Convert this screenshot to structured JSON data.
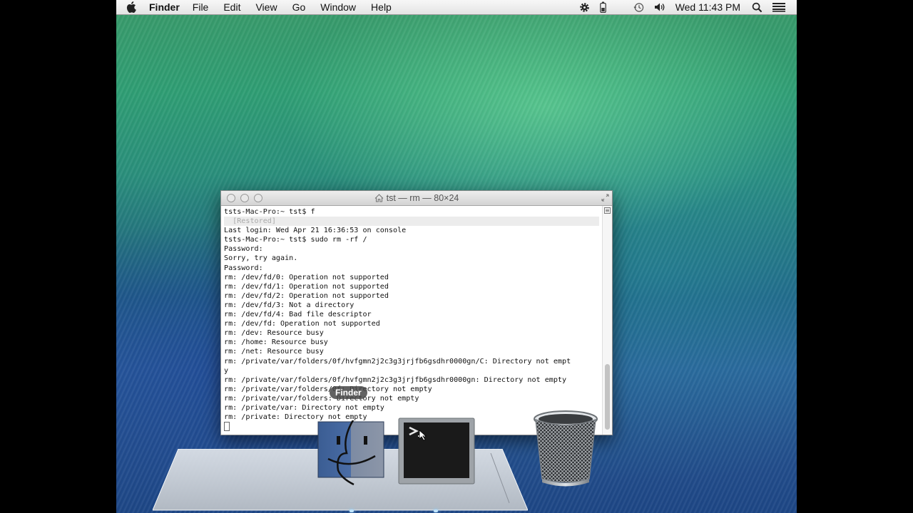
{
  "menubar": {
    "app_name": "Finder",
    "items": [
      "File",
      "Edit",
      "View",
      "Go",
      "Window",
      "Help"
    ],
    "clock": "Wed 11:43 PM",
    "status_icons": [
      "gear-icon",
      "battery-icon",
      "time-machine-icon",
      "volume-icon",
      "search-icon",
      "list-icon"
    ]
  },
  "terminal": {
    "title": "tst — rm — 80×24",
    "lines": [
      "tsts-Mac-Pro:~ tst$ f",
      "  [Restored]",
      "Last login: Wed Apr 21 16:36:53 on console",
      "tsts-Mac-Pro:~ tst$ sudo rm -rf /",
      "Password:",
      "Sorry, try again.",
      "Password:",
      "rm: /dev/fd/0: Operation not supported",
      "rm: /dev/fd/1: Operation not supported",
      "rm: /dev/fd/2: Operation not supported",
      "rm: /dev/fd/3: Not a directory",
      "rm: /dev/fd/4: Bad file descriptor",
      "rm: /dev/fd: Operation not supported",
      "rm: /dev: Resource busy",
      "rm: /home: Resource busy",
      "rm: /net: Resource busy",
      "rm: /private/var/folders/0f/hvfgmn2j2c3g3jrjfb6gsdhr0000gn/C: Directory not empt",
      "y",
      "rm: /private/var/folders/0f/hvfgmn2j2c3g3jrjfb6gsdhr0000gn: Directory not empty",
      "rm: /private/var/folders/0f: Directory not empty",
      "rm: /private/var/folders: Directory not empty",
      "rm: /private/var: Directory not empty",
      "rm: /private: Directory not empty"
    ]
  },
  "dock": {
    "tooltip": "Finder",
    "items": [
      "Finder",
      "Terminal",
      "Trash"
    ]
  }
}
